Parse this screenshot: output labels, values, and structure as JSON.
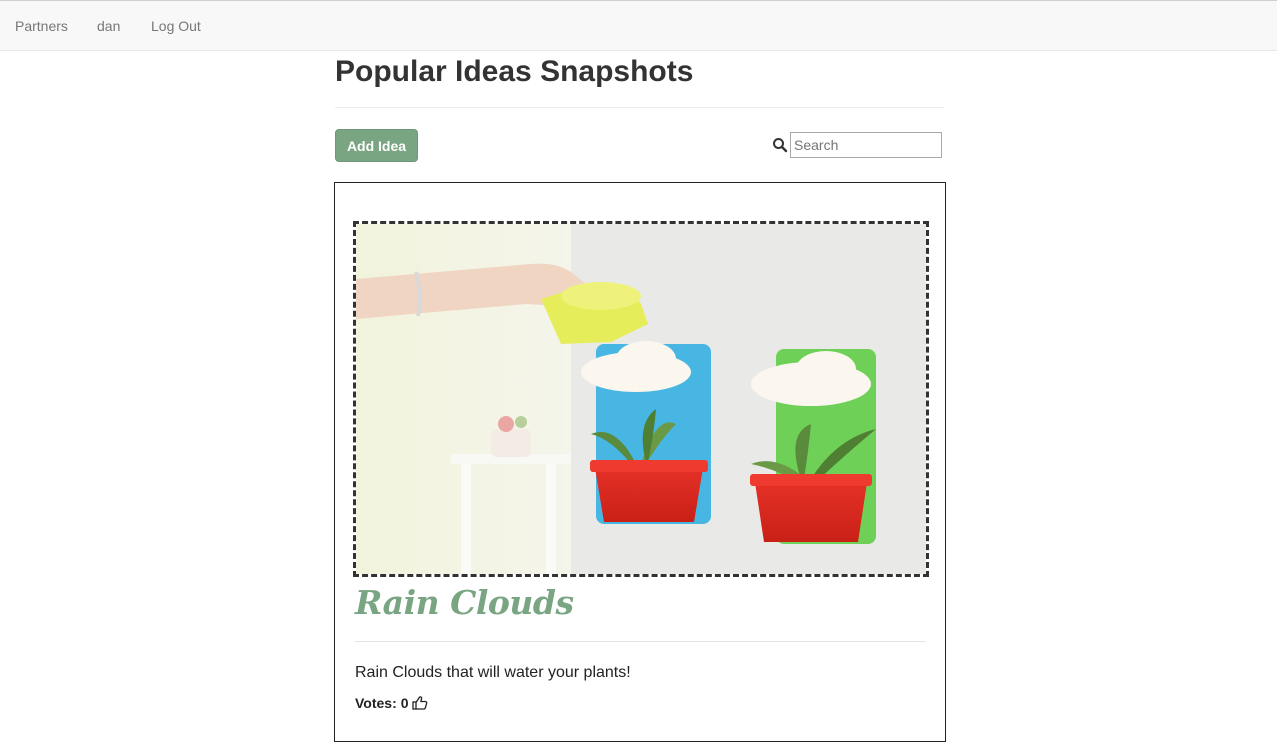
{
  "nav": {
    "items": [
      {
        "label": "Partners"
      },
      {
        "label": "dan"
      },
      {
        "label": "Log Out"
      }
    ]
  },
  "page": {
    "title": "Popular Ideas Snapshots"
  },
  "toolbar": {
    "add_label": "Add Idea",
    "search_placeholder": "Search",
    "search_icon": "search-icon"
  },
  "idea": {
    "title": "Rain Clouds",
    "description": "Rain Clouds that will water your plants!",
    "votes_label": "Votes:",
    "votes_count": "0",
    "vote_icon": "thumbs-up-icon",
    "accent_color": "#7aa583"
  }
}
